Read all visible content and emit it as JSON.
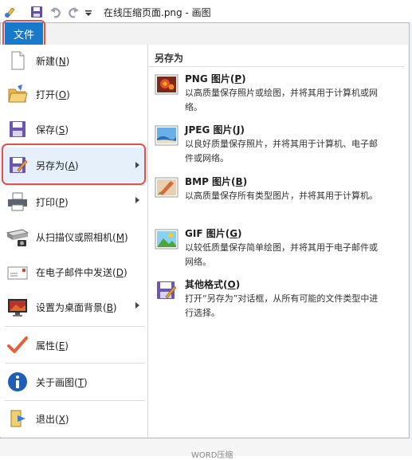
{
  "window": {
    "title": "在线压缩页面.png - 画图"
  },
  "file_tab": {
    "label": "文件"
  },
  "menu": {
    "items": [
      {
        "name": "new",
        "label": "新建(",
        "key": "N",
        "end": ")"
      },
      {
        "name": "open",
        "label": "打开(",
        "key": "O",
        "end": ")"
      },
      {
        "name": "save",
        "label": "保存(",
        "key": "S",
        "end": ")"
      },
      {
        "name": "save-as",
        "label": "另存为(",
        "key": "A",
        "end": ")"
      },
      {
        "name": "print",
        "label": "打印(",
        "key": "P",
        "end": ")"
      },
      {
        "name": "scanner",
        "label": "从扫描仪或照相机(",
        "key": "M",
        "end": ")"
      },
      {
        "name": "email",
        "label": "在电子邮件中发送(",
        "key": "D",
        "end": ")"
      },
      {
        "name": "desktop",
        "label": "设置为桌面背景(",
        "key": "B",
        "end": ")"
      },
      {
        "name": "properties",
        "label": "属性(",
        "key": "E",
        "end": ")"
      },
      {
        "name": "about",
        "label": "关于画图(",
        "key": "T",
        "end": ")"
      },
      {
        "name": "exit",
        "label": "退出(",
        "key": "X",
        "end": ")"
      }
    ]
  },
  "save_as": {
    "heading": "另存为",
    "options": [
      {
        "title": "PNG 图片(",
        "key": "P",
        "end": ")",
        "desc": "以高质量保存照片或绘图，并将其用于计算机或网络。"
      },
      {
        "title": "JPEG 图片(",
        "key": "J",
        "end": ")",
        "desc": "以良好质量保存照片，并将其用于计算机、电子邮件或网络。"
      },
      {
        "title": "BMP 图片(",
        "key": "B",
        "end": ")",
        "desc": "以高质量保存所有类型图片，并将其用于计算机。"
      },
      {
        "title": "GIF 图片(",
        "key": "G",
        "end": ")",
        "desc": "以较低质量保存简单绘图，并将其用于电子邮件或网络。"
      },
      {
        "title": "其他格式(",
        "key": "O",
        "end": ")",
        "desc": "打开“另存为”对话框，从所有可能的文件类型中进行选择。"
      }
    ]
  },
  "background": {
    "bottom_text": "WORD压缩"
  },
  "colors": {
    "accent": "#1979ca",
    "highlight": "#e0524a",
    "hover": "#e5f0fb"
  }
}
